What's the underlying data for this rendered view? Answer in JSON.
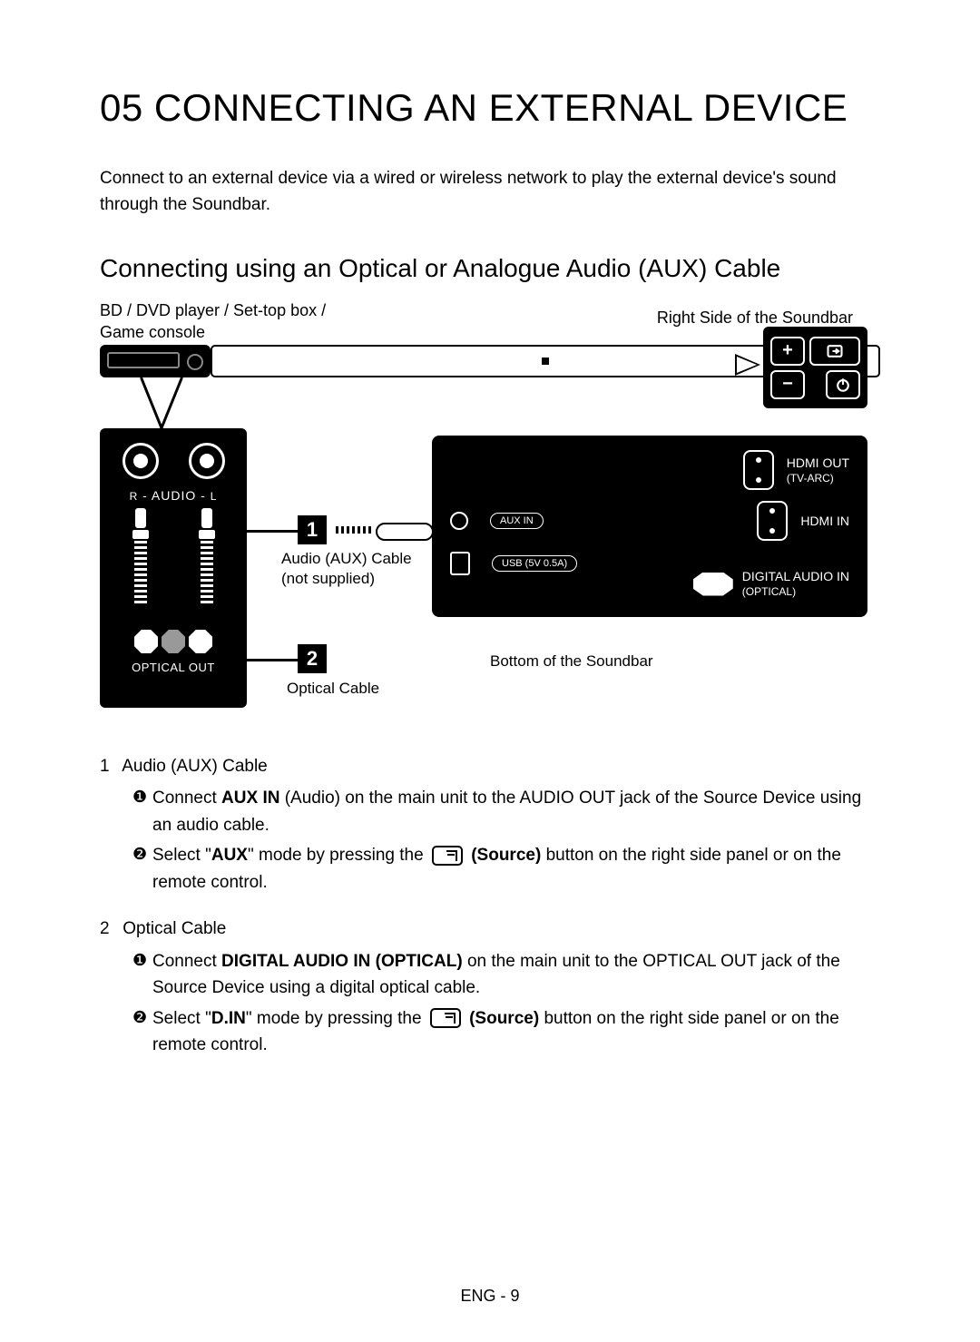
{
  "chapter": {
    "number": "05",
    "title": "CONNECTING AN EXTERNAL DEVICE"
  },
  "intro": "Connect to an external device via a wired or wireless network to play the external device's sound through the Soundbar.",
  "section_title": "Connecting using an Optical or Analogue Audio (AUX) Cable",
  "diagram": {
    "source_device_label": "BD / DVD player / Set-top box / Game console",
    "right_side_label": "Right Side of the Soundbar",
    "rca_left": "L",
    "rca_right": "R",
    "rca_audio": "- AUDIO -",
    "optical_out": "OPTICAL OUT",
    "callout1": "1",
    "callout2": "2",
    "aux_cable_label_1": "Audio (AUX) Cable",
    "aux_cable_label_2": "(not supplied)",
    "optical_cable_label": "Optical Cable",
    "bottom_label": "Bottom of the Soundbar",
    "ports": {
      "hdmi_out": "HDMI OUT",
      "hdmi_out_sub": "(TV-ARC)",
      "hdmi_in": "HDMI IN",
      "aux_in": "AUX IN",
      "usb": "USB (5V 0.5A)",
      "digital_in": "DIGITAL AUDIO IN",
      "digital_in_sub": "(OPTICAL)"
    }
  },
  "instructions": {
    "item1": {
      "num": "1",
      "title": "Audio (AUX) Cable",
      "a_prefix": "Connect ",
      "a_bold": "AUX IN",
      "a_rest": " (Audio) on the main unit to the AUDIO OUT jack of the Source Device using an audio cable.",
      "b_prefix": "Select \"",
      "b_bold": "AUX",
      "b_mid": "\" mode by pressing the ",
      "b_source": "(Source)",
      "b_rest": " button on the right side panel or on the remote control."
    },
    "item2": {
      "num": "2",
      "title": "Optical Cable",
      "a_prefix": "Connect ",
      "a_bold": "DIGITAL AUDIO IN (OPTICAL)",
      "a_rest": " on the main unit to the OPTICAL OUT jack of the Source Device using a digital optical cable.",
      "b_prefix": "Select \"",
      "b_bold": "D.IN",
      "b_mid": "\" mode by pressing the ",
      "b_source": "(Source)",
      "b_rest": " button on the right side panel or on the remote control."
    }
  },
  "page_number": "ENG - 9",
  "bullets": {
    "b1": "❶",
    "b2": "❷"
  }
}
